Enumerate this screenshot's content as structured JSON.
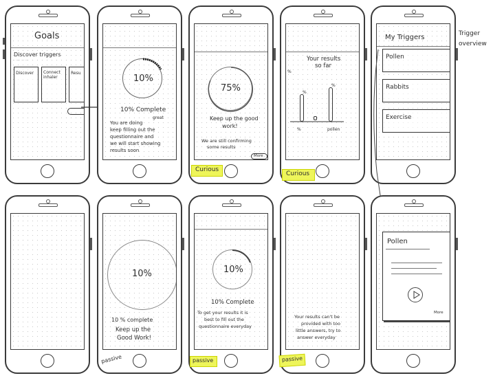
{
  "annotations": {
    "trigger_overview": "Trigger overview"
  },
  "screens": {
    "goals": {
      "title": "Goals",
      "subtitle": "Discover triggers",
      "cards": [
        "Discover",
        "Connect inhaler",
        "Resu"
      ]
    },
    "progress10": {
      "percent": "10%",
      "status": "10% Complete",
      "note_a": "You are doing",
      "note_great": "great",
      "note_b": "keep filling out the",
      "note_c": "questionnaire and",
      "note_d": "we will start showing",
      "note_e": "results soon"
    },
    "progress75": {
      "percent": "75%",
      "line1": "Keep up the good",
      "line2": "work!",
      "line3": "We are still confirming",
      "line4": "some results",
      "more": "More",
      "tag": "Curious"
    },
    "results": {
      "title_a": "Your results",
      "title_b": "so far",
      "left_label": "%",
      "label_a": "%",
      "label_b": "%",
      "x_labels": [
        "%",
        "pollen"
      ],
      "tag": "Curious"
    },
    "triggers": {
      "title": "My Triggers",
      "items": [
        "Pollen",
        "Rabbits",
        "Exercise"
      ]
    },
    "passive10": {
      "percent": "10%",
      "status": "10 % complete",
      "line1": "Keep up the",
      "line2": "Good Work!",
      "tag": "passive"
    },
    "passive10b": {
      "percent": "10%",
      "status": "10% Complete",
      "line1": "To get your results it is",
      "line2": "best to fill out the",
      "line3": "questionnaire everyday",
      "tag": "passive"
    },
    "passive_text": {
      "line1": "Your results can't be",
      "line2": "provided with too",
      "line3": "little answers, try to",
      "line4": "answer everyday",
      "tag": "passive"
    },
    "pollen_detail": {
      "title": "Pollen",
      "more": "More"
    }
  }
}
